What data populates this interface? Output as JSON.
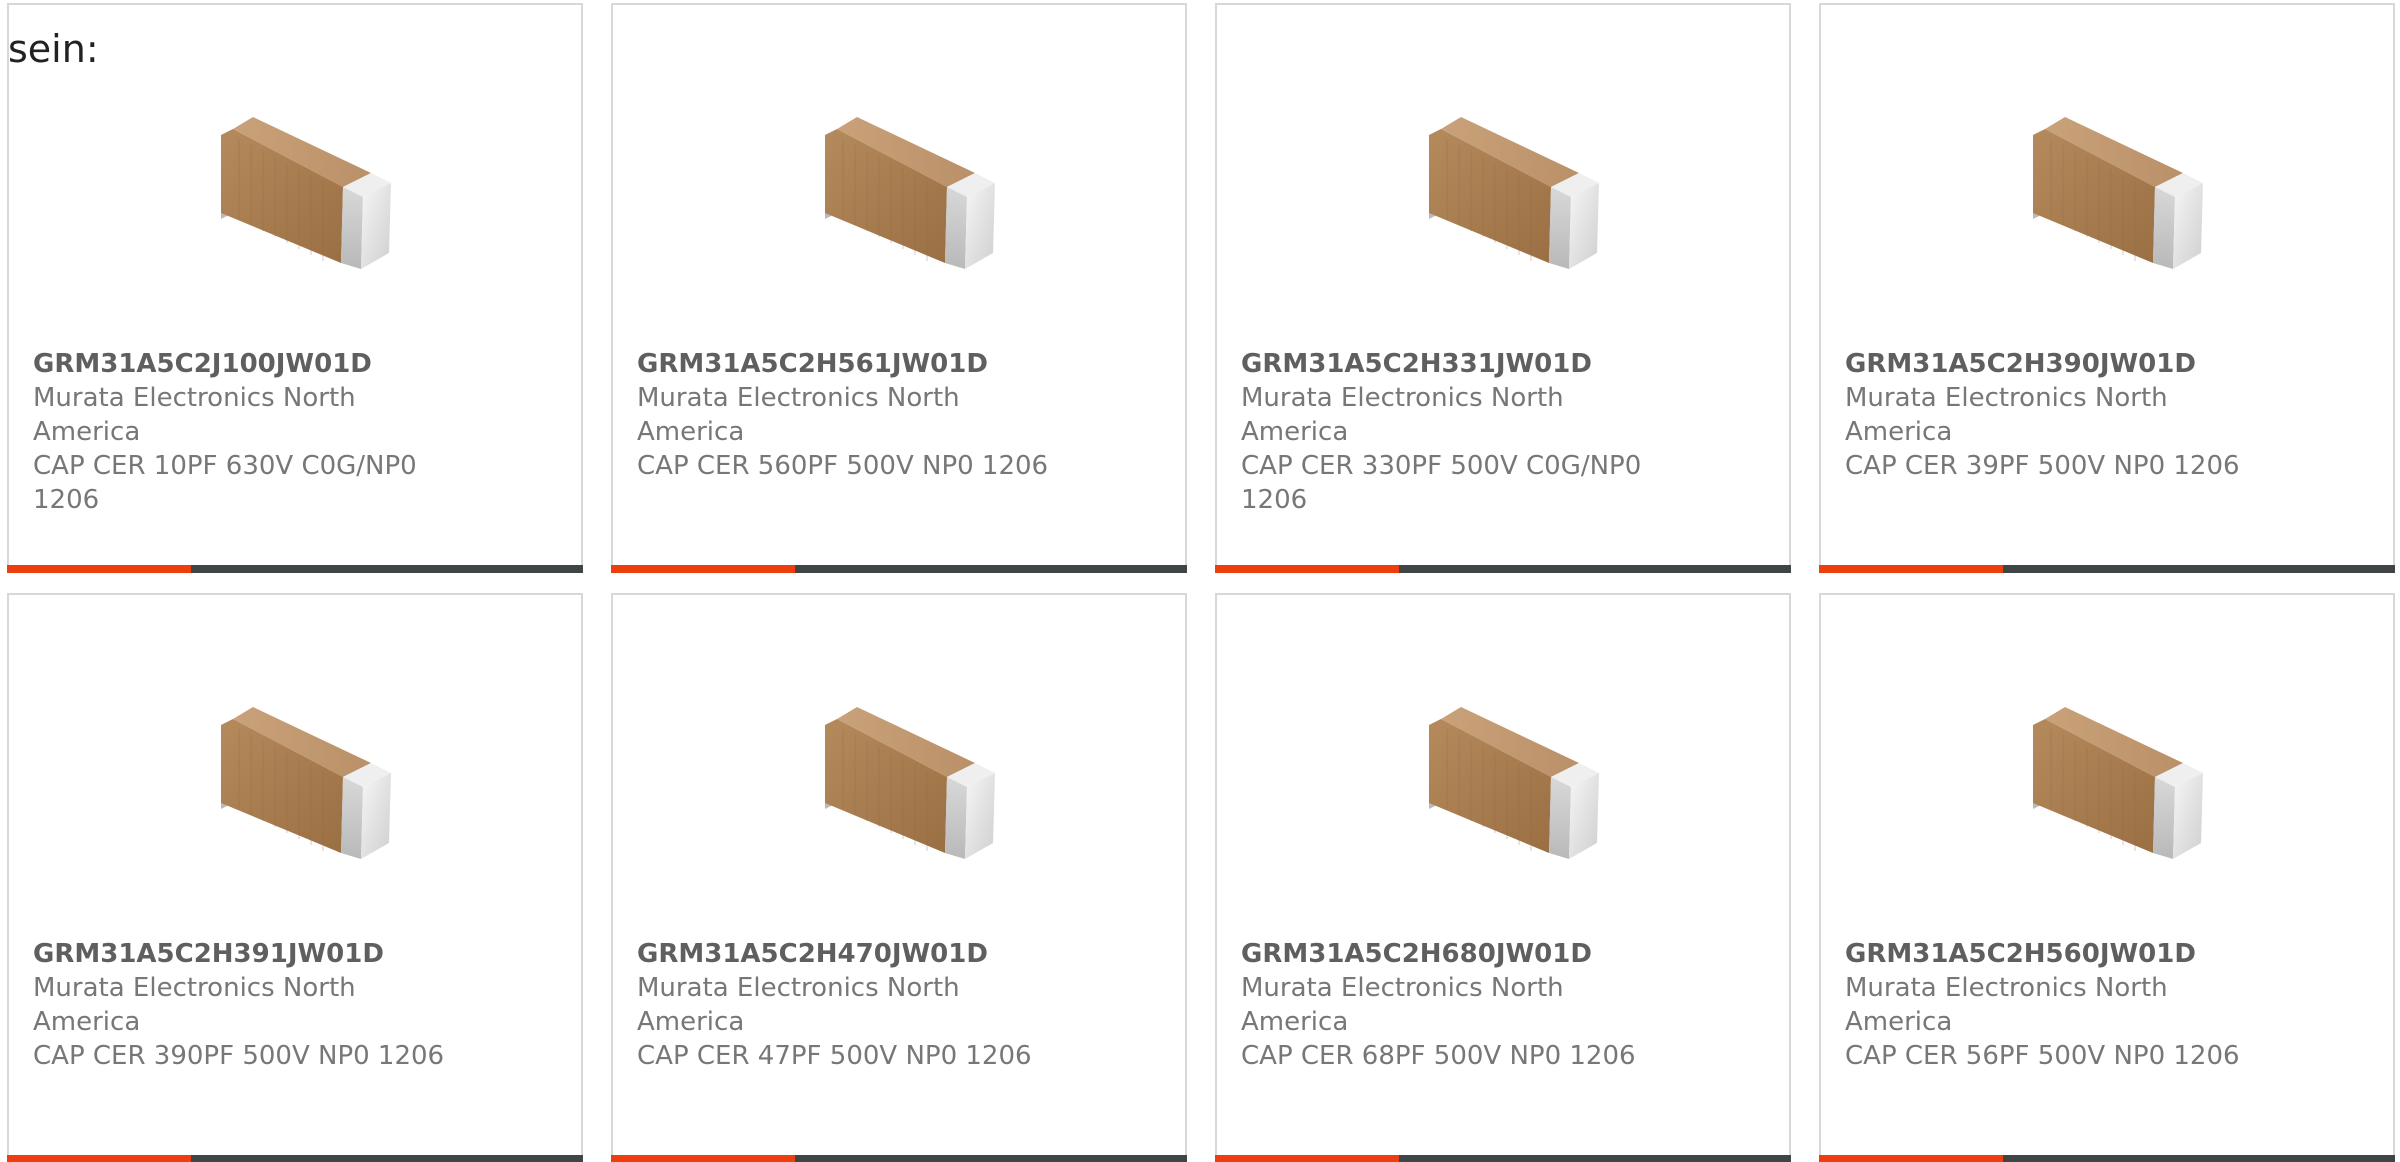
{
  "intro_text": "sein:",
  "colors": {
    "accent": "#ec3e0f",
    "bar": "#3f4447",
    "border": "#d8d8d8",
    "title": "#5f5f5f",
    "text": "#777777"
  },
  "products": [
    {
      "part_number": "GRM31A5C2J100JW01D",
      "manufacturer": "Murata Electronics North America",
      "description": "CAP CER 10PF 630V C0G/NP0 1206",
      "image_icon": "ceramic-capacitor-chip-icon"
    },
    {
      "part_number": "GRM31A5C2H561JW01D",
      "manufacturer": "Murata Electronics North America",
      "description": "CAP CER 560PF 500V NP0 1206",
      "image_icon": "ceramic-capacitor-chip-icon"
    },
    {
      "part_number": "GRM31A5C2H331JW01D",
      "manufacturer": "Murata Electronics North America",
      "description": "CAP CER 330PF 500V C0G/NP0 1206",
      "image_icon": "ceramic-capacitor-chip-icon"
    },
    {
      "part_number": "GRM31A5C2H390JW01D",
      "manufacturer": "Murata Electronics North America",
      "description": "CAP CER 39PF 500V NP0 1206",
      "image_icon": "ceramic-capacitor-chip-icon"
    },
    {
      "part_number": "GRM31A5C2H391JW01D",
      "manufacturer": "Murata Electronics North America",
      "description": "CAP CER 390PF 500V NP0 1206",
      "image_icon": "ceramic-capacitor-chip-icon"
    },
    {
      "part_number": "GRM31A5C2H470JW01D",
      "manufacturer": "Murata Electronics North America",
      "description": "CAP CER 47PF 500V NP0 1206",
      "image_icon": "ceramic-capacitor-chip-icon"
    },
    {
      "part_number": "GRM31A5C2H680JW01D",
      "manufacturer": "Murata Electronics North America",
      "description": "CAP CER 68PF 500V NP0 1206",
      "image_icon": "ceramic-capacitor-chip-icon"
    },
    {
      "part_number": "GRM31A5C2H560JW01D",
      "manufacturer": "Murata Electronics North America",
      "description": "CAP CER 56PF 500V NP0 1206",
      "image_icon": "ceramic-capacitor-chip-icon"
    }
  ]
}
